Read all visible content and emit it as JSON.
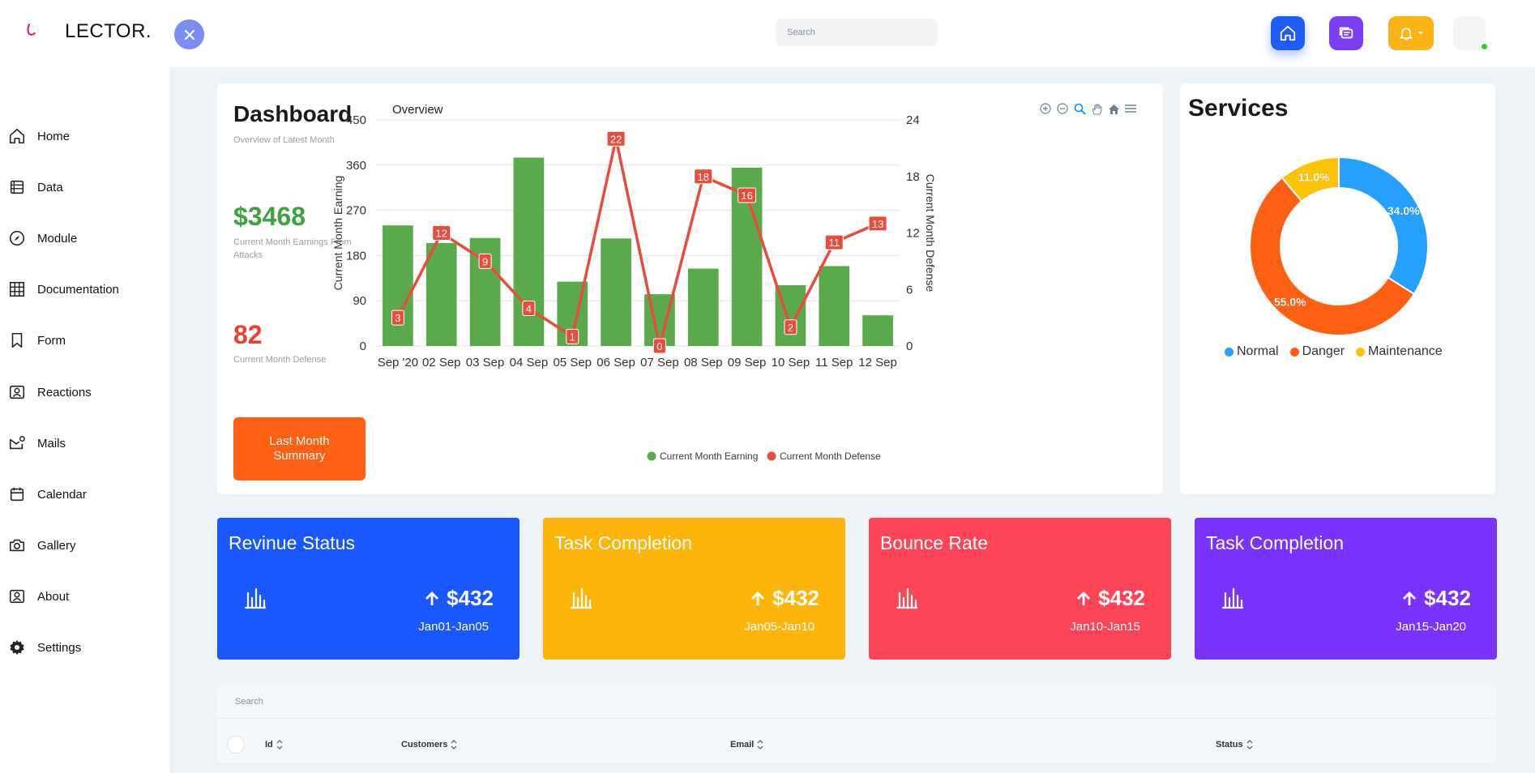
{
  "header": {
    "logo_text": "LECTOR.",
    "search_placeholder": "Search",
    "icons": [
      "home-icon",
      "chat-icon",
      "bell-icon",
      "avatar"
    ]
  },
  "sidebar": {
    "items": [
      {
        "label": "Home",
        "icon": "home-icon"
      },
      {
        "label": "Data",
        "icon": "data-icon"
      },
      {
        "label": "Module",
        "icon": "compass-icon"
      },
      {
        "label": "Documentation",
        "icon": "grid-icon"
      },
      {
        "label": "Form",
        "icon": "bookmark-icon"
      },
      {
        "label": "Reactions",
        "icon": "person-badge-icon"
      },
      {
        "label": "Mails",
        "icon": "mail-icon"
      },
      {
        "label": "Calendar",
        "icon": "calendar-icon"
      },
      {
        "label": "Gallery",
        "icon": "camera-icon"
      },
      {
        "label": "About",
        "icon": "person-badge-icon"
      },
      {
        "label": "Settings",
        "icon": "gear-icon"
      }
    ]
  },
  "dashboard": {
    "title": "Dashboard",
    "subtitle": "Overview of Latest Month",
    "earnings_value": "$3468",
    "earnings_label": "Current Month Earnings From Attacks",
    "defense_value": "82",
    "defense_label": "Current Month Defense",
    "button_label": "Last Month Summary",
    "chart_title": "Overview"
  },
  "chart_data": [
    {
      "type": "bar",
      "title": "Overview",
      "categories": [
        "Sep '20",
        "02 Sep",
        "03 Sep",
        "04 Sep",
        "05 Sep",
        "06 Sep",
        "07 Sep",
        "08 Sep",
        "09 Sep",
        "10 Sep",
        "11 Sep",
        "12 Sep"
      ],
      "series": [
        {
          "name": "Current Month Earning",
          "type": "bar",
          "axis": "left",
          "color": "#5aaa4d",
          "values": [
            240,
            205,
            215,
            375,
            128,
            214,
            103,
            154,
            355,
            121,
            159,
            61
          ]
        },
        {
          "name": "Current Month Defense",
          "type": "line",
          "axis": "right",
          "color": "#e74c3c",
          "values": [
            3,
            12,
            9,
            4,
            1,
            22,
            0,
            18,
            16,
            2,
            11,
            13
          ]
        }
      ],
      "ylabel": "Current Month Earning",
      "ylabel_right": "Current Month Defense",
      "ylim": [
        0,
        450
      ],
      "yticks": [
        0,
        90,
        180,
        270,
        360,
        450
      ],
      "ylim_right": [
        0,
        24
      ],
      "yticks_right": [
        0,
        6,
        12,
        18,
        24
      ],
      "legend": "bottom",
      "grid": true
    },
    {
      "type": "pie",
      "title": "Services",
      "categories": [
        "Normal",
        "Danger",
        "Maintenance"
      ],
      "values": [
        34.0,
        55.0,
        11.0
      ],
      "labels": [
        "34.0%",
        "55.0%",
        "11.0%"
      ],
      "colors": [
        "#26a0fc",
        "#fd6012",
        "#fdc307"
      ],
      "legend": "bottom"
    }
  ],
  "services": {
    "title": "Services"
  },
  "stats": [
    {
      "title": "Revinue Status",
      "value": "$432",
      "range": "Jan01-Jan05",
      "color": "#1a57ff"
    },
    {
      "title": "Task Completion",
      "value": "$432",
      "range": "Jan05-Jan10",
      "color": "#fdb509"
    },
    {
      "title": "Bounce Rate",
      "value": "$432",
      "range": "Jan10-Jan15",
      "color": "#fe4457"
    },
    {
      "title": "Task Completion",
      "value": "$432",
      "range": "Jan15-Jan20",
      "color": "#7a33ff"
    }
  ],
  "table": {
    "search_placeholder": "Search",
    "columns": [
      "Id",
      "Customers",
      "Email",
      "Status"
    ]
  }
}
